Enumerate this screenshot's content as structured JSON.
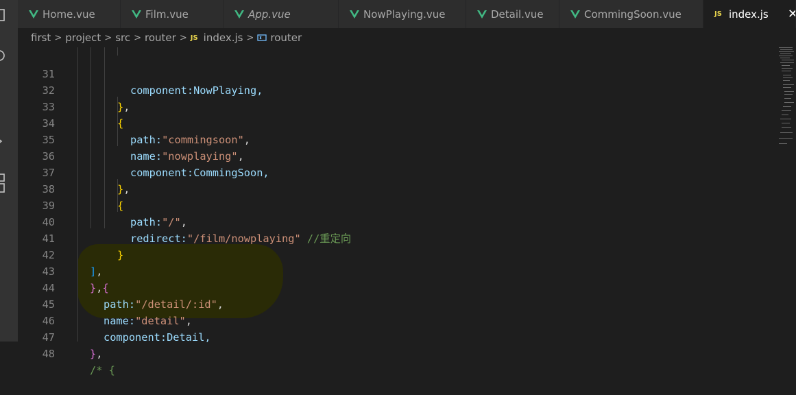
{
  "tabs": [
    {
      "label": "Home.vue",
      "icon": "vue-icon",
      "italic": false,
      "active": false
    },
    {
      "label": "Film.vue",
      "icon": "vue-icon",
      "italic": false,
      "active": false
    },
    {
      "label": "App.vue",
      "icon": "vue-icon",
      "italic": true,
      "active": false
    },
    {
      "label": "NowPlaying.vue",
      "icon": "vue-icon",
      "italic": false,
      "active": false
    },
    {
      "label": "Detail.vue",
      "icon": "vue-icon",
      "italic": false,
      "active": false
    },
    {
      "label": "CommingSoon.vue",
      "icon": "vue-icon",
      "italic": false,
      "active": false
    },
    {
      "label": "index.js",
      "icon": "js-icon",
      "italic": false,
      "active": true
    }
  ],
  "tab_js_badge": "JS",
  "tab_close": "✕",
  "breadcrumb": {
    "items": [
      "first",
      "project",
      "src",
      "router"
    ],
    "file_badge": "JS",
    "file": "index.js",
    "symbol": "router"
  },
  "code_lines": [
    {
      "n": "31"
    },
    {
      "n": "32"
    },
    {
      "n": "33"
    },
    {
      "n": "34"
    },
    {
      "n": "35"
    },
    {
      "n": "36"
    },
    {
      "n": "37"
    },
    {
      "n": "38"
    },
    {
      "n": "39"
    },
    {
      "n": "40"
    },
    {
      "n": "41"
    },
    {
      "n": "42"
    },
    {
      "n": "43"
    },
    {
      "n": "44"
    },
    {
      "n": "45"
    },
    {
      "n": "46"
    },
    {
      "n": "47"
    },
    {
      "n": "48"
    }
  ],
  "code": {
    "l31": "component:NowPlaying,",
    "l34_key": "path:",
    "l34_val": "\"commingsoon\"",
    "l35_key": "name:",
    "l35_val": "\"nowplaying\"",
    "l36": "component:CommingSoon,",
    "l39_key": "path:",
    "l39_val": "\"/\"",
    "l40_key": "redirect:",
    "l40_val": "\"/film/nowplaying\"",
    "l40_comment": "//重定向",
    "l44_key": "path:",
    "l44_val": "\"/detail/:id\"",
    "l45_key": "name:",
    "l45_val": "\"detail\"",
    "l46": "component:Detail,",
    "l48": "/* {"
  },
  "colors": {
    "editor_bg": "#1e1e1e",
    "keyword": "#9cdcfe",
    "string": "#ce9178",
    "comment": "#6a9955",
    "highlight": "#2a2b06",
    "vue_green": "#41b883",
    "js_yellow": "#e8d44d"
  }
}
